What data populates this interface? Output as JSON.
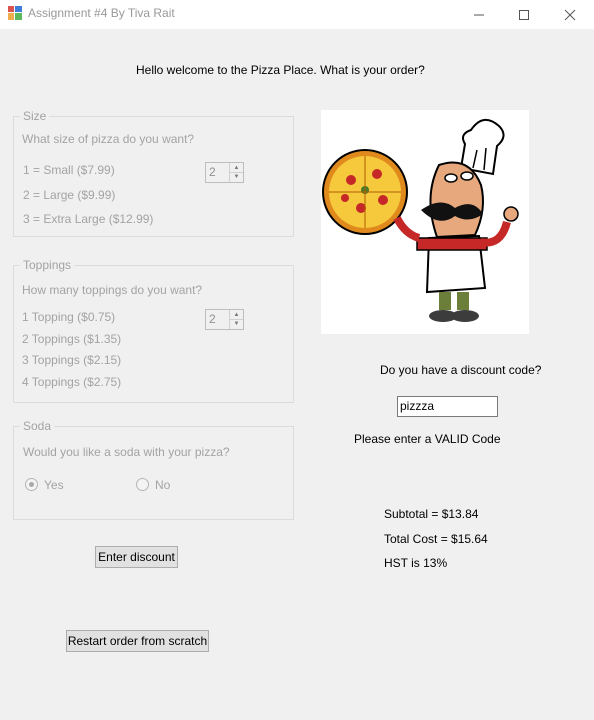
{
  "window": {
    "title": "Assignment #4 By Tiva Rait"
  },
  "greeting": "Hello welcome to the Pizza Place. What is your order?",
  "size": {
    "legend": "Size",
    "question": "What size of pizza do you want?",
    "options": [
      "1 = Small ($7.99)",
      "2 = Large ($9.99)",
      "3 = Extra Large ($12.99)"
    ],
    "value": "2"
  },
  "toppings": {
    "legend": "Toppings",
    "question": "How many toppings do you want?",
    "options": [
      "1 Topping ($0.75)",
      "2 Toppings ($1.35)",
      "3 Toppings ($2.15)",
      "4 Toppings ($2.75)"
    ],
    "value": "2"
  },
  "soda": {
    "legend": "Soda",
    "question": "Would you like a soda with your pizza?",
    "yes_label": "Yes",
    "no_label": "No",
    "selected": "Yes"
  },
  "discount": {
    "question": "Do you have a discount code?",
    "code_value": "pizzza",
    "message": "Please enter a VALID Code",
    "button_label": "Enter discount"
  },
  "totals": {
    "subtotal": "Subtotal = $13.84",
    "total": "Total Cost = $15.64",
    "hst": "HST is 13%"
  },
  "restart_label": "Restart order from scratch",
  "icons": [
    "app-icon",
    "minimize-icon",
    "maximize-icon",
    "close-icon",
    "chef-pizza-image"
  ]
}
